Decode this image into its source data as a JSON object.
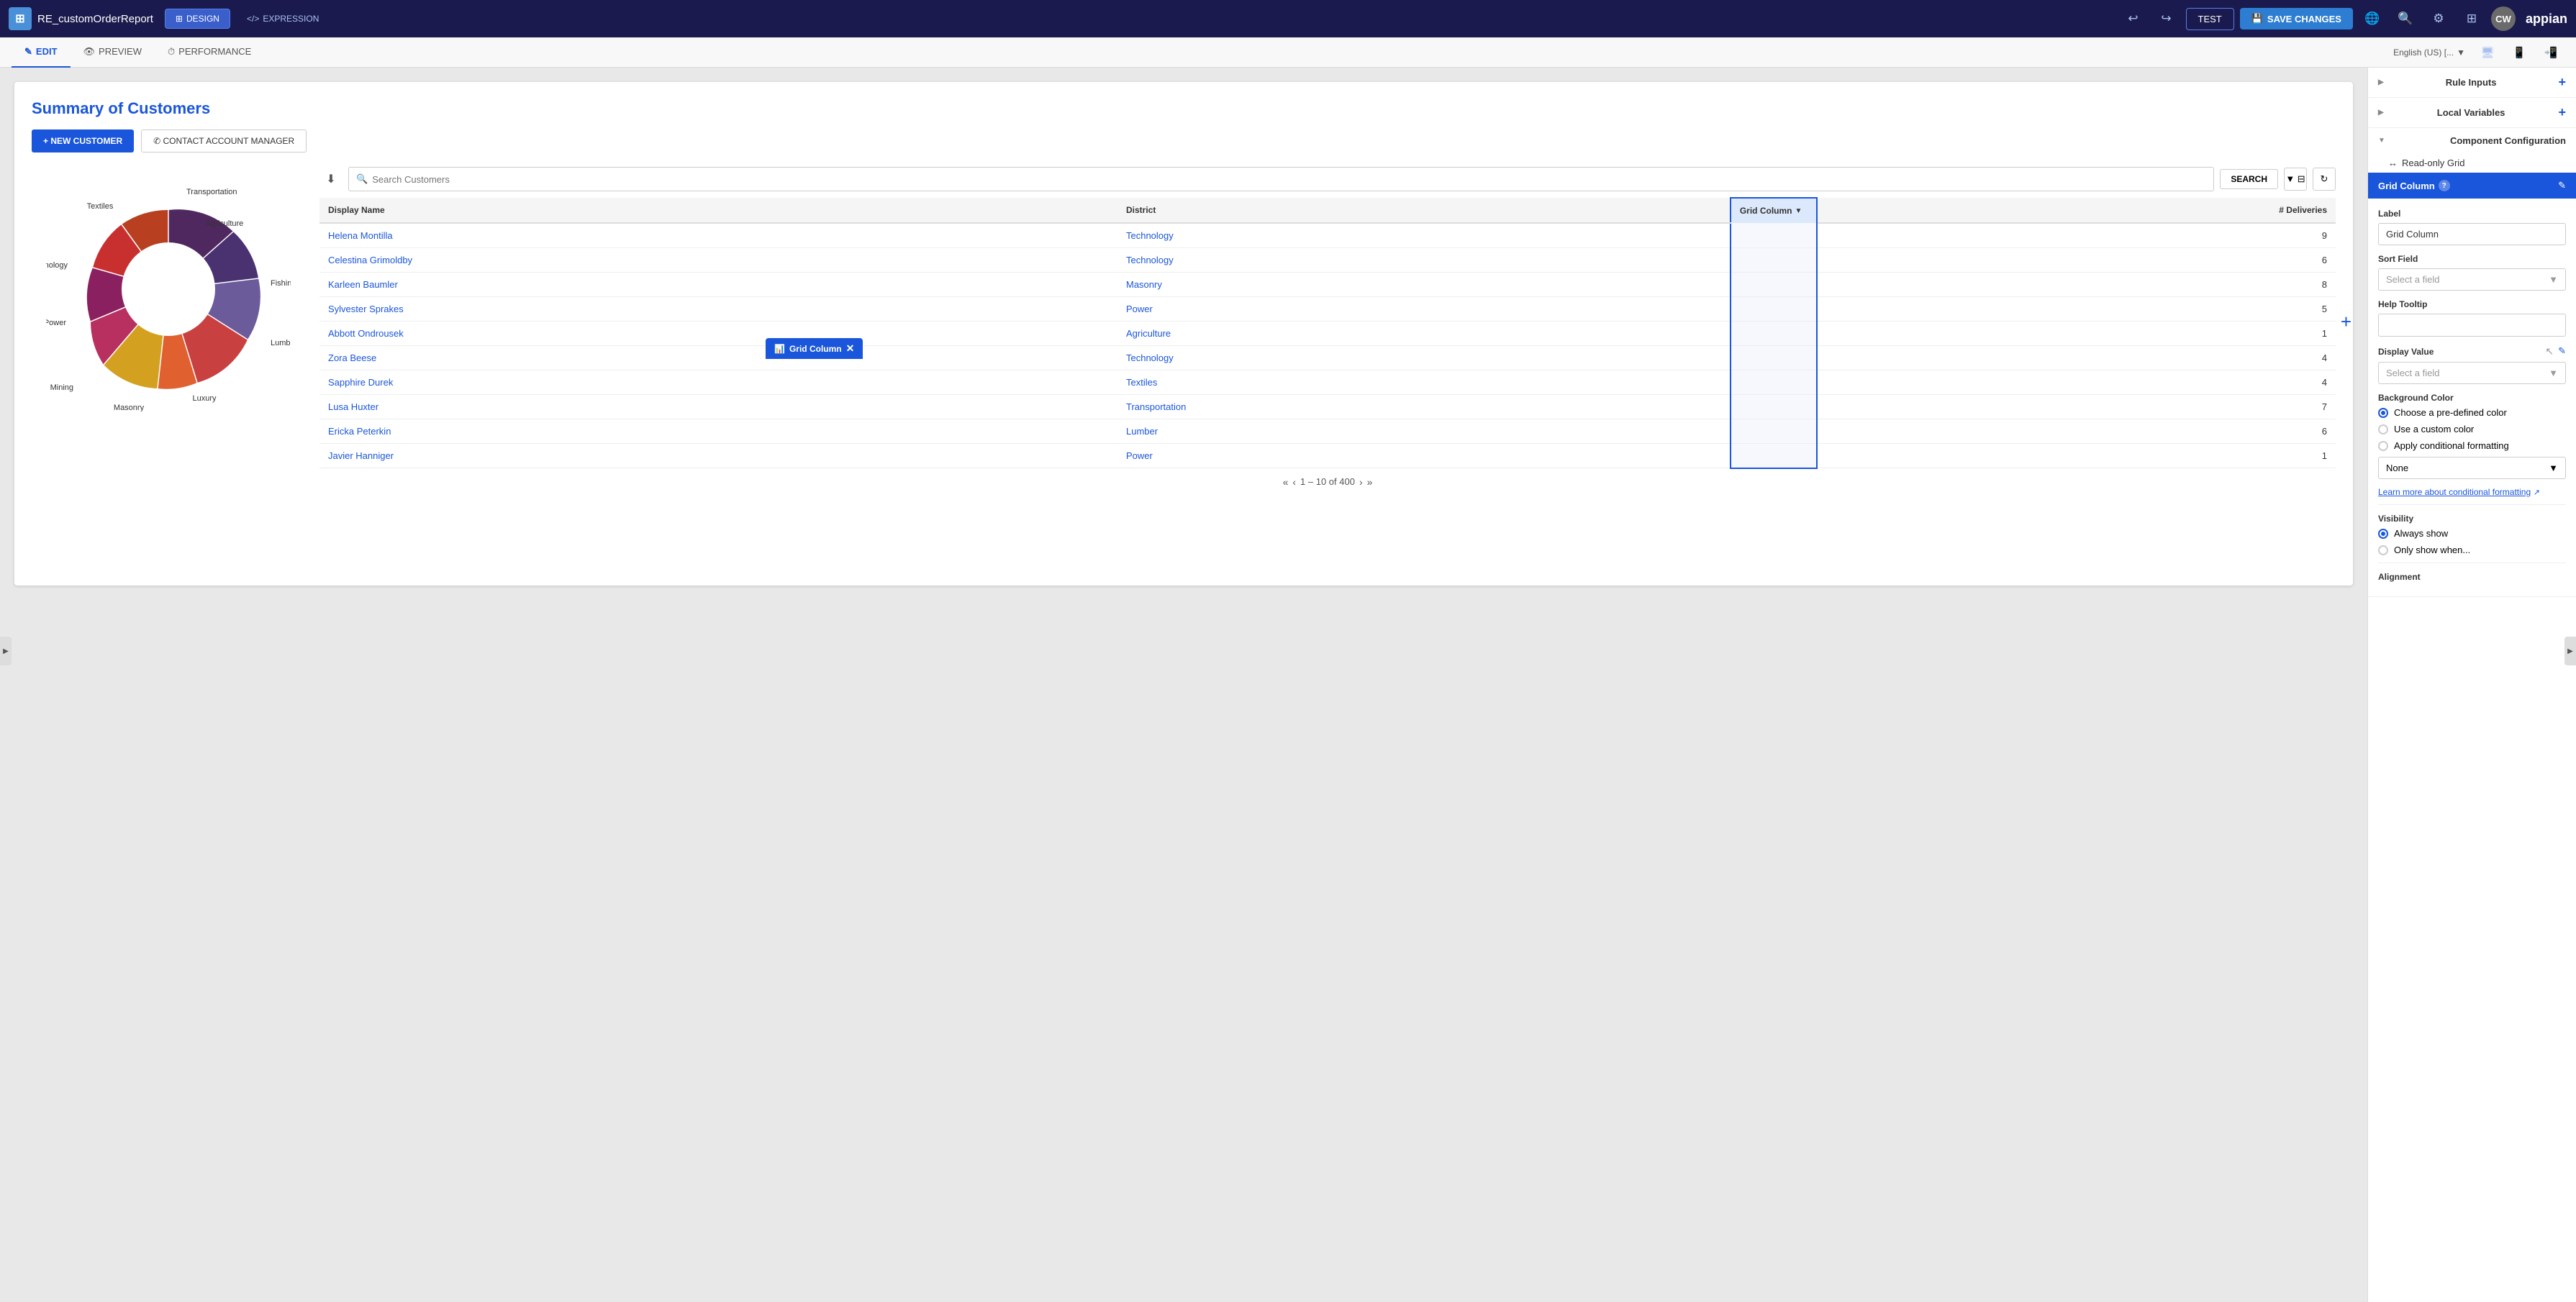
{
  "app": {
    "title": "RE_customOrderReport",
    "icon": "⊞"
  },
  "topnav": {
    "design_label": "DESIGN",
    "expression_label": "EXPRESSION",
    "test_label": "TEST",
    "save_label": "SAVE CHANGES",
    "avatar": "CW",
    "appian_logo": "appian"
  },
  "subnav": {
    "edit_label": "EDIT",
    "preview_label": "PREVIEW",
    "performance_label": "PERFORMANCE",
    "locale": "English (US) [..."
  },
  "canvas": {
    "page_title": "Summary of Customers",
    "new_customer_btn": "+ NEW CUSTOMER",
    "contact_btn": "✆ CONTACT ACCOUNT MANAGER",
    "search_placeholder": "Search Customers",
    "search_btn": "SEARCH"
  },
  "table": {
    "columns": [
      "Display Name",
      "District",
      "Grid Column",
      "# Deliveries"
    ],
    "rows": [
      {
        "name": "Helena Montilla",
        "district": "Technology",
        "deliveries": 9
      },
      {
        "name": "Celestina Grimoldby",
        "district": "Technology",
        "deliveries": 6
      },
      {
        "name": "Karleen Baumler",
        "district": "Masonry",
        "deliveries": 8
      },
      {
        "name": "Sylvester Sprakes",
        "district": "Power",
        "deliveries": 5
      },
      {
        "name": "Abbott Ondrousek",
        "district": "Agriculture",
        "deliveries": 1
      },
      {
        "name": "Zora Beese",
        "district": "Technology",
        "deliveries": 4
      },
      {
        "name": "Sapphire Durek",
        "district": "Textiles",
        "deliveries": 4
      },
      {
        "name": "Lusa Huxter",
        "district": "Transportation",
        "deliveries": 7
      },
      {
        "name": "Ericka Peterkin",
        "district": "Lumber",
        "deliveries": 6
      },
      {
        "name": "Javier Hanniger",
        "district": "Power",
        "deliveries": 1
      }
    ],
    "pagination": "1 – 10 of 400",
    "grid_column_label": "Grid Column",
    "grid_column_popup": "Grid Column"
  },
  "donut": {
    "segments": [
      {
        "label": "Agriculture",
        "color": "#4a3270",
        "angle": 38
      },
      {
        "label": "Fishing",
        "color": "#6b5b9a",
        "angle": 32
      },
      {
        "label": "Lumber",
        "color": "#c94040",
        "angle": 42
      },
      {
        "label": "Luxury",
        "color": "#e06030",
        "angle": 30
      },
      {
        "label": "Masonry",
        "color": "#d4a020",
        "angle": 38
      },
      {
        "label": "Mining",
        "color": "#b83060",
        "angle": 30
      },
      {
        "label": "Power",
        "color": "#8b2060",
        "angle": 38
      },
      {
        "label": "Technology",
        "color": "#c83030",
        "angle": 42
      },
      {
        "label": "Textiles",
        "color": "#b84020",
        "angle": 30
      },
      {
        "label": "Transportation",
        "color": "#502860",
        "angle": 40
      }
    ]
  },
  "right_panel": {
    "rule_inputs_label": "Rule Inputs",
    "local_variables_label": "Local Variables",
    "component_config_label": "Component Configuration",
    "read_only_grid_label": "Read-only Grid",
    "grid_column_label": "Grid Column",
    "question_mark": "?",
    "edit_icon": "✎",
    "label_section": "Label",
    "label_value": "Grid Column",
    "sort_field_label": "Sort Field",
    "sort_field_placeholder": "Select a field",
    "help_tooltip_label": "Help Tooltip",
    "display_value_label": "Display Value",
    "display_value_placeholder": "Select a field",
    "background_color_label": "Background Color",
    "radio_predefined": "Choose a pre-defined color",
    "radio_custom": "Use a custom color",
    "radio_conditional": "Apply conditional formatting",
    "none_label": "None",
    "learn_more": "Learn more about conditional formatting",
    "visibility_label": "Visibility",
    "radio_always": "Always show",
    "radio_when": "Only show when...",
    "alignment_label": "Alignment"
  }
}
